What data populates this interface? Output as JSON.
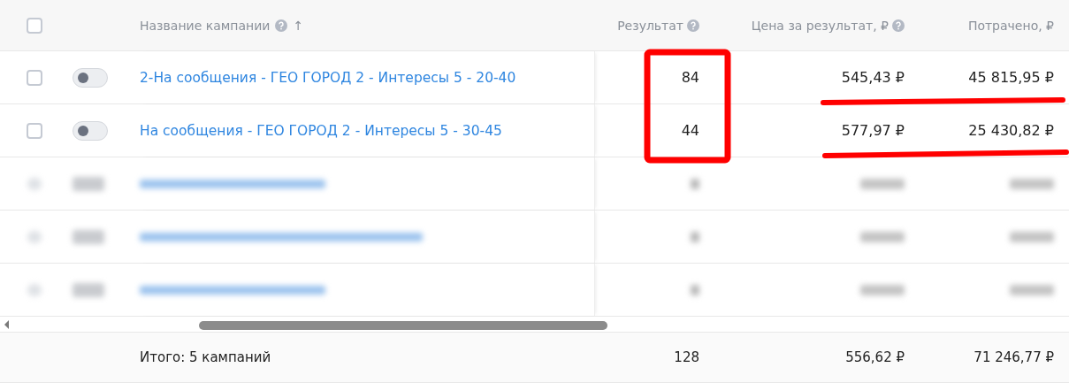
{
  "table": {
    "header": {
      "checked": false,
      "columns": [
        {
          "label": "Название кампании",
          "help": true,
          "sort": "↑"
        },
        {
          "label": "Результат",
          "help": true
        },
        {
          "label": "Цена за результат, ₽",
          "help": true
        },
        {
          "label": "Потрачено, ₽",
          "help": false
        }
      ]
    },
    "rows": [
      {
        "kind": "campaign",
        "checked": false,
        "on": false,
        "name": "2-На сообщения - ГЕО ГОРОД 2 - Интересы 5 - 20-40",
        "result": "84",
        "price": "545,43 ₽",
        "spent": "45 815,95 ₽"
      },
      {
        "kind": "campaign",
        "checked": false,
        "on": false,
        "name": "На сообщения - ГЕО ГОРОД 2 - Интересы 5 - 30-45",
        "result": "44",
        "price": "577,97 ₽",
        "spent": "25 430,82 ₽"
      },
      {
        "kind": "blurred",
        "checked": false,
        "on": false
      },
      {
        "kind": "blurred",
        "checked": false,
        "on": false
      },
      {
        "kind": "blurred",
        "checked": false,
        "on": false
      }
    ],
    "footer": {
      "label": "Итого: 5 кампаний",
      "result": "128",
      "price": "556,62 ₽",
      "spent": "71 246,77 ₽"
    }
  },
  "annotations": [
    {
      "kind": "box"
    },
    {
      "kind": "underline"
    },
    {
      "kind": "underline"
    }
  ]
}
